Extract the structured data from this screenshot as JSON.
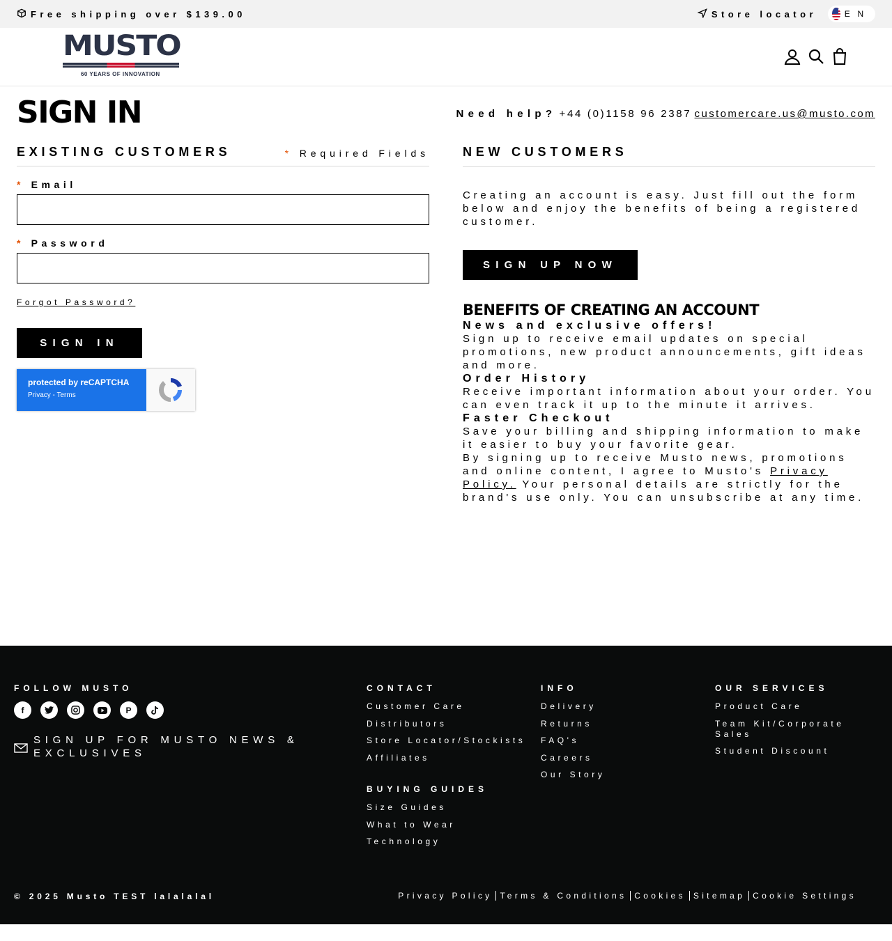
{
  "announcement": {
    "shipping": "Free shipping over $139.00",
    "store_locator": "Store locator",
    "language": "EN"
  },
  "header": {
    "logo_text": "MUSTO",
    "logo_tagline": "60 YEARS OF INNOVATION",
    "icons": [
      "account-icon",
      "search-icon",
      "bag-icon"
    ]
  },
  "page": {
    "title": "SIGN IN",
    "help_label": "Need help?",
    "help_phone": "+44 (0)1158 96 2387",
    "help_email": "customercare.us@musto.com"
  },
  "existing": {
    "heading": "EXISTING CUSTOMERS",
    "required_marker": "*",
    "required_text": "Required Fields",
    "email_label": "Email",
    "email_value": "",
    "password_label": "Password",
    "password_value": "",
    "forgot": "Forgot Password?",
    "signin_button": "SIGN IN",
    "recaptcha_line1": "protected by reCAPTCHA",
    "recaptcha_line2": "Privacy - Terms"
  },
  "new_customers": {
    "heading": "NEW CUSTOMERS",
    "intro": "Creating an account is easy. Just fill out the form below and enjoy the benefits of being a registered customer.",
    "signup_button": "SIGN UP NOW",
    "benefits_heading": "BENEFITS OF CREATING AN ACCOUNT",
    "benefits": [
      {
        "title": "News and exclusive offers!",
        "text": "Sign up to receive email updates on special promotions, new product announcements, gift ideas and more."
      },
      {
        "title": "Order History",
        "text": "Receive important information about your order. You can even track it up to the minute it arrives."
      },
      {
        "title": "Faster Checkout",
        "text": "Save your billing and shipping information to make it easier to buy your favorite gear."
      }
    ],
    "legal_before": "By signing up to receive Musto news, promotions and online content, I agree to Musto's",
    "legal_link": "Privacy Policy.",
    "legal_after": "Your personal details are strictly for the brand's use only. You can unsubscribe at any time."
  },
  "footer": {
    "follow": "FOLLOW MUSTO",
    "socials": [
      "facebook-icon",
      "twitter-icon",
      "instagram-icon",
      "youtube-icon",
      "pinterest-icon",
      "tiktok-icon"
    ],
    "newsletter": "SIGN UP FOR MUSTO NEWS & EXCLUSIVES",
    "contact": {
      "title": "CONTACT",
      "links": [
        "Customer Care",
        "Distributors",
        "Store Locator/Stockists",
        "Affiliates"
      ]
    },
    "buying": {
      "title": "BUYING GUIDES",
      "links": [
        "Size Guides",
        "What to Wear",
        "Technology"
      ]
    },
    "info": {
      "title": "INFO",
      "links": [
        "Delivery",
        "Returns",
        "FAQ's",
        "Careers",
        "Our Story"
      ]
    },
    "services": {
      "title": "OUR SERVICES",
      "links": [
        "Product Care",
        "Team Kit/Corporate Sales",
        "Student Discount"
      ]
    },
    "copyright": "© 2025 Musto TEST lalalalal",
    "legal_links": [
      "Privacy Policy",
      "Terms & Conditions",
      "Cookies",
      "Sitemap",
      "Cookie Settings"
    ]
  }
}
